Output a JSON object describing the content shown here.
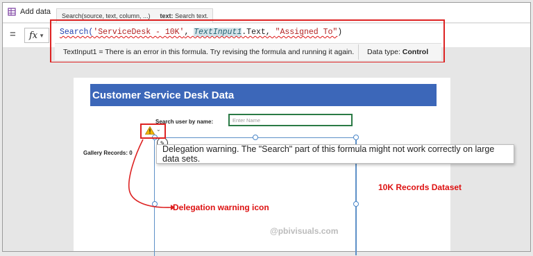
{
  "toolbar": {
    "add_data_label": "Add data",
    "db_icon": "database-icon"
  },
  "signature_hint": {
    "signature": "Search(source, text, column, ...)",
    "param_name": "text:",
    "param_desc": " Search text."
  },
  "formula_bar": {
    "equals": "=",
    "fx_label": "fx",
    "parts": {
      "fn": "Search(",
      "arg1": "'ServiceDesk - 10K'",
      "comma1": ", ",
      "ctl": "TextInput1",
      "prop": ".Text, ",
      "arg3": "\"Assigned To\"",
      "close": ")"
    }
  },
  "error_bar": {
    "message": "TextInput1  =  There is an error in this formula. Try revising the formula and running it again.",
    "datatype_label": "Data type: ",
    "datatype_value": "Control"
  },
  "screen": {
    "title": "Customer Service Desk Data",
    "search_label": "Search user by name:",
    "search_placeholder": "Enter Name",
    "gallery_records_label": "Gallery Records:  0"
  },
  "tooltip": {
    "text": "Delegation warning. The \"Search\" part of this formula might not work correctly on large data sets."
  },
  "annotations": {
    "callout": "Delegation warning icon",
    "dataset": "10K Records Dataset",
    "watermark": "@pbivisuals.com"
  },
  "colors": {
    "banner": "#3c67b9",
    "annotation_red": "#d22222",
    "input_border": "#2a7a45",
    "gallery_border": "#5c8fc7"
  }
}
